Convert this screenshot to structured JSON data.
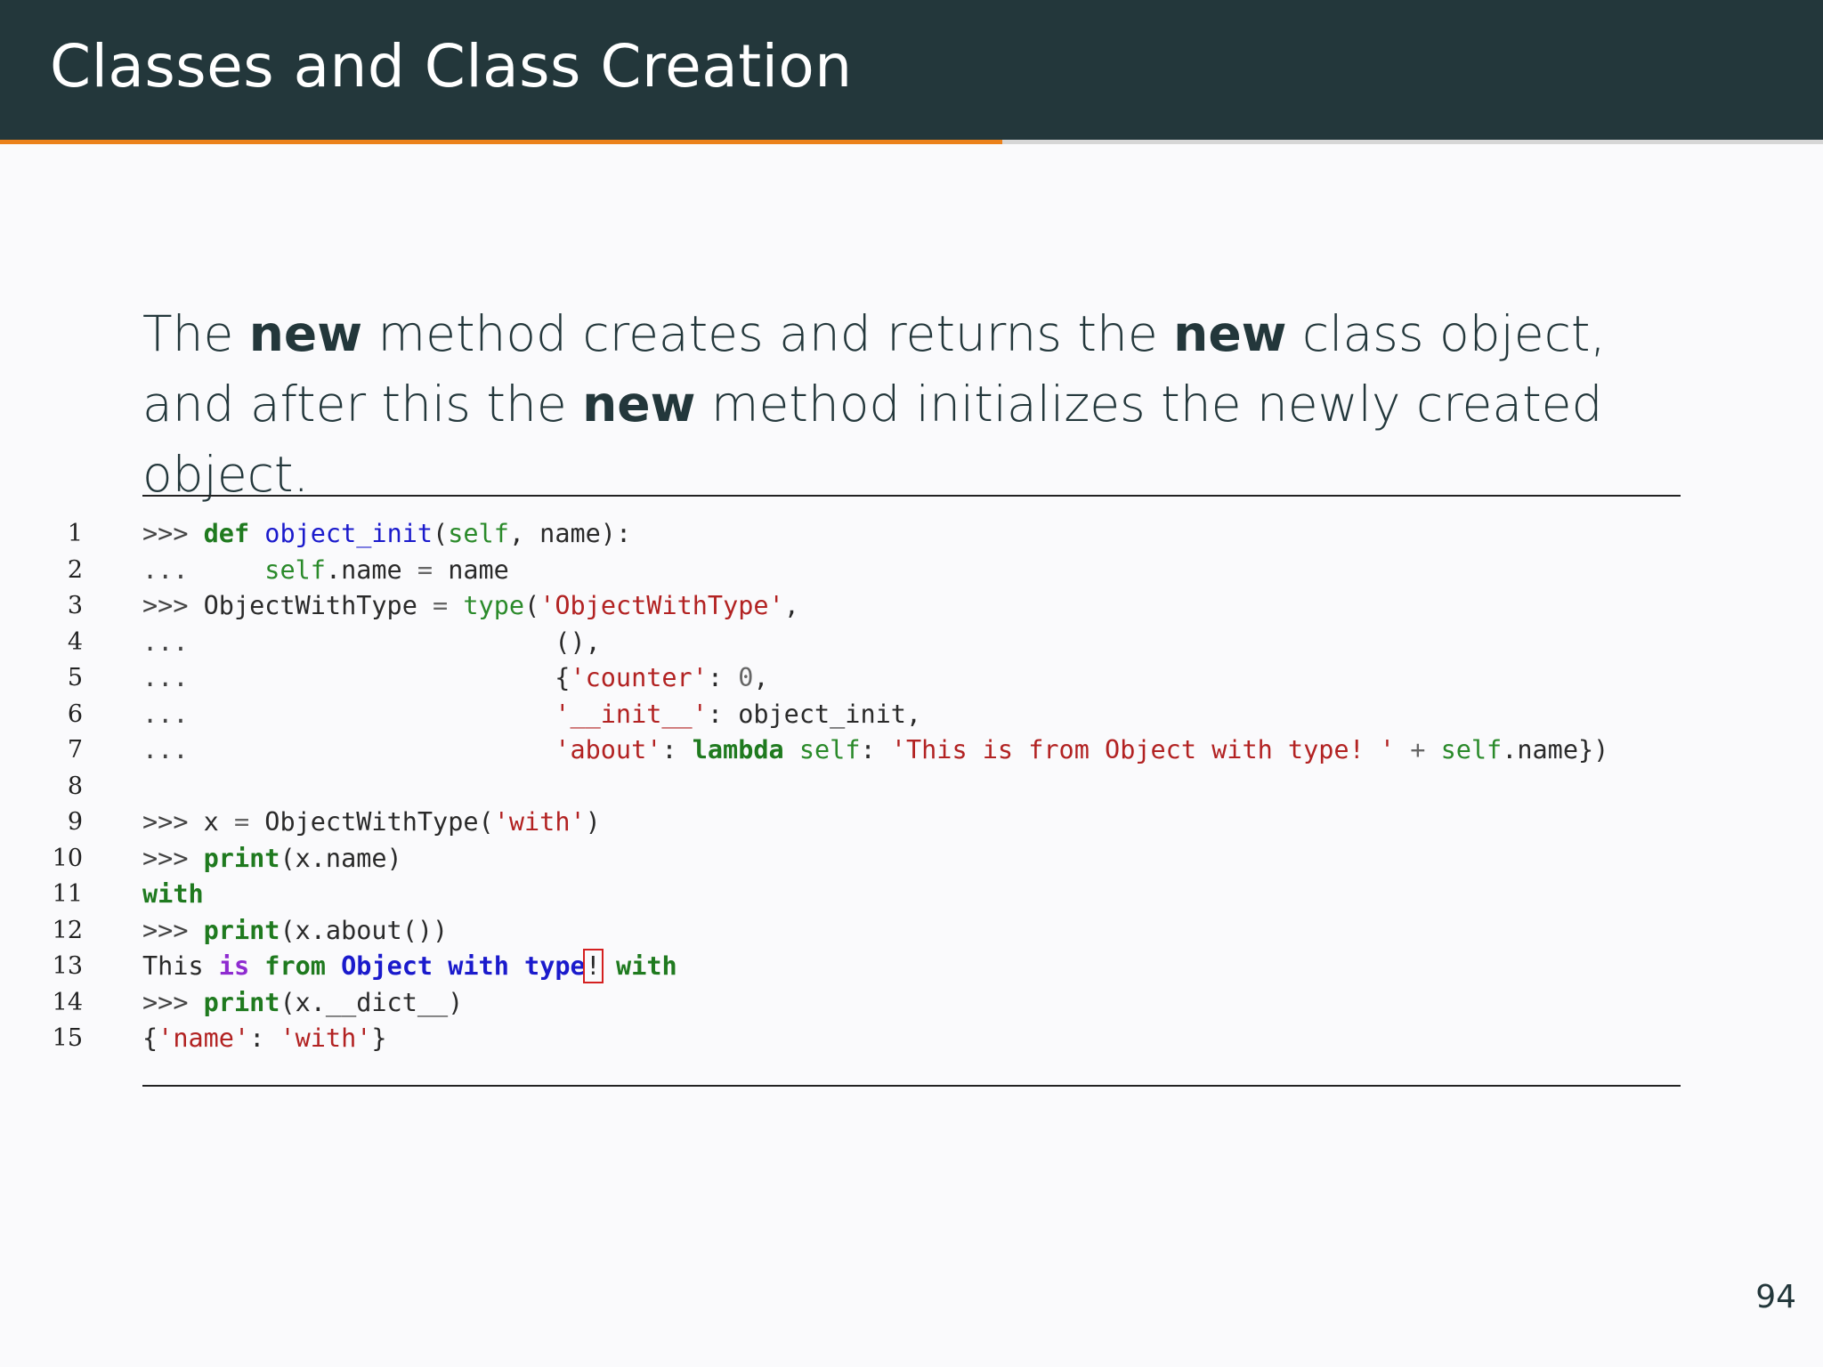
{
  "slide": {
    "title": "Classes and Class Creation",
    "progress_fraction": 0.55,
    "page_number": "94"
  },
  "intro": [
    {
      "text": "The ",
      "bold": false
    },
    {
      "text": "new",
      "bold": true
    },
    {
      "text": " method creates and returns the ",
      "bold": false
    },
    {
      "text": "new",
      "bold": true
    },
    {
      "text": " class object, and after this the ",
      "bold": false
    },
    {
      "text": "new",
      "bold": true
    },
    {
      "text": " method initializes the newly created object.",
      "bold": false
    }
  ],
  "code": {
    "lines": [
      {
        "n": "1",
        "tokens": [
          [
            "pr",
            ">>> "
          ],
          [
            "kw",
            "def"
          ],
          [
            "pl",
            " "
          ],
          [
            "fn",
            "object_init"
          ],
          [
            "pl",
            "("
          ],
          [
            "bi",
            "self"
          ],
          [
            "pl",
            ", name):"
          ]
        ]
      },
      {
        "n": "2",
        "tokens": [
          [
            "pr",
            "...     "
          ],
          [
            "bi",
            "self"
          ],
          [
            "pl",
            ".name "
          ],
          [
            "op",
            "="
          ],
          [
            "pl",
            " name"
          ]
        ]
      },
      {
        "n": "3",
        "tokens": [
          [
            "pr",
            ">>> "
          ],
          [
            "pl",
            "ObjectWithType "
          ],
          [
            "op",
            "="
          ],
          [
            "pl",
            " "
          ],
          [
            "bi",
            "type"
          ],
          [
            "pl",
            "("
          ],
          [
            "str",
            "'ObjectWithType'"
          ],
          [
            "pl",
            ","
          ]
        ]
      },
      {
        "n": "4",
        "tokens": [
          [
            "pr",
            "...                        "
          ],
          [
            "pl",
            "(),"
          ]
        ]
      },
      {
        "n": "5",
        "tokens": [
          [
            "pr",
            "...                        "
          ],
          [
            "pl",
            "{"
          ],
          [
            "str",
            "'counter'"
          ],
          [
            "pl",
            ": "
          ],
          [
            "num",
            "0"
          ],
          [
            "pl",
            ","
          ]
        ]
      },
      {
        "n": "6",
        "tokens": [
          [
            "pr",
            "...                        "
          ],
          [
            "str",
            "'__init__'"
          ],
          [
            "pl",
            ": object_init,"
          ]
        ]
      },
      {
        "n": "7",
        "tokens": [
          [
            "pr",
            "...                        "
          ],
          [
            "str",
            "'about'"
          ],
          [
            "pl",
            ": "
          ],
          [
            "kw",
            "lambda"
          ],
          [
            "pl",
            " "
          ],
          [
            "bi",
            "self"
          ],
          [
            "pl",
            ": "
          ],
          [
            "str",
            "'This is from Object with type! '"
          ],
          [
            "pl",
            " "
          ],
          [
            "op",
            "+"
          ],
          [
            "pl",
            " "
          ],
          [
            "bi",
            "self"
          ],
          [
            "pl",
            ".name})"
          ]
        ]
      },
      {
        "n": "8",
        "tokens": []
      },
      {
        "n": "9",
        "tokens": [
          [
            "pr",
            ">>> "
          ],
          [
            "pl",
            "x "
          ],
          [
            "op",
            "="
          ],
          [
            "pl",
            " ObjectWithType("
          ],
          [
            "str",
            "'with'"
          ],
          [
            "pl",
            ")"
          ]
        ]
      },
      {
        "n": "10",
        "tokens": [
          [
            "pr",
            ">>> "
          ],
          [
            "kw",
            "print"
          ],
          [
            "pl",
            "(x.name)"
          ]
        ]
      },
      {
        "n": "11",
        "tokens": [
          [
            "o-gk",
            "with"
          ]
        ]
      },
      {
        "n": "12",
        "tokens": [
          [
            "pr",
            ">>> "
          ],
          [
            "kw",
            "print"
          ],
          [
            "pl",
            "(x.about())"
          ]
        ]
      },
      {
        "n": "13",
        "tokens": [
          [
            "o-pl",
            "This "
          ],
          [
            "o-kw",
            "is"
          ],
          [
            "o-pl",
            " "
          ],
          [
            "o-gk",
            "from"
          ],
          [
            "o-pl",
            " "
          ],
          [
            "o-bk",
            "Object"
          ],
          [
            "o-pl",
            " "
          ],
          [
            "o-bk",
            "with"
          ],
          [
            "o-pl",
            " "
          ],
          [
            "o-bk",
            "type"
          ],
          [
            "o-err",
            "!"
          ],
          [
            "o-pl",
            " "
          ],
          [
            "o-gk",
            "with"
          ]
        ]
      },
      {
        "n": "14",
        "tokens": [
          [
            "pr",
            ">>> "
          ],
          [
            "kw",
            "print"
          ],
          [
            "pl",
            "(x.__dict__)"
          ]
        ]
      },
      {
        "n": "15",
        "tokens": [
          [
            "pl",
            "{"
          ],
          [
            "str",
            "'name'"
          ],
          [
            "pl",
            ": "
          ],
          [
            "str",
            "'with'"
          ],
          [
            "pl",
            "}"
          ]
        ]
      }
    ]
  },
  "colors": {
    "header_bg": "#23373b",
    "accent": "#eb811b",
    "background": "#fafafc",
    "keyword": "#1f7a1f",
    "string": "#b22222",
    "function": "#1a1acc",
    "error_box": "#d42020"
  }
}
